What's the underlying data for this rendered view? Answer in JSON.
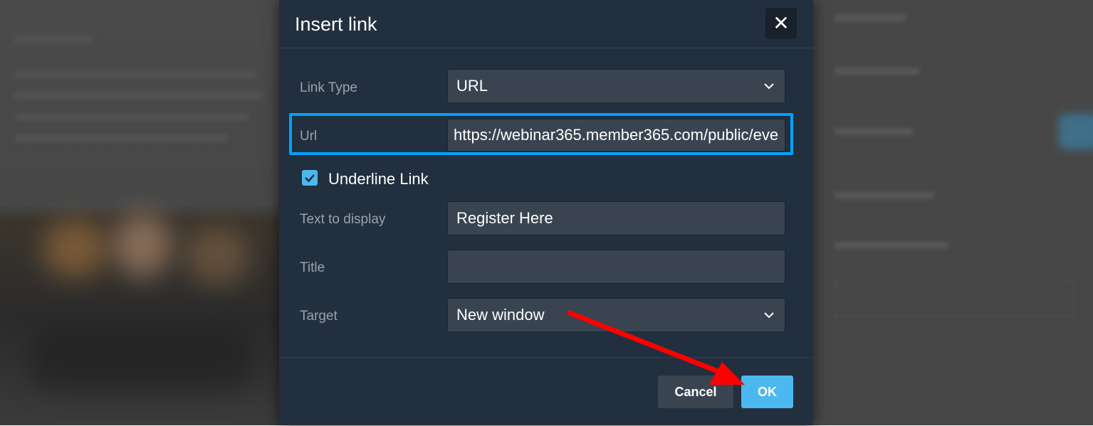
{
  "dialog": {
    "title": "Insert link",
    "close_glyph": "✕"
  },
  "fields": {
    "link_type_label": "Link Type",
    "link_type_value": "URL",
    "url_label": "Url",
    "url_value": "https://webinar365.member365.com/public/eve",
    "underline_label": "Underline Link",
    "underline_checked": true,
    "text_to_display_label": "Text to display",
    "text_to_display_value": "Register Here",
    "title_label": "Title",
    "title_value": "",
    "target_label": "Target",
    "target_value": "New window"
  },
  "footer": {
    "cancel_label": "Cancel",
    "ok_label": "OK"
  },
  "colors": {
    "dialog_bg": "#222f3e",
    "field_bg": "#3a4451",
    "accent": "#4cb8f0",
    "highlight": "#00a2ff",
    "annotation_arrow": "#ff0000"
  },
  "icons": {
    "close": "close-icon",
    "dropdown": "chevron-down-icon",
    "check": "checkmark-icon",
    "annotation": "red-arrow-annotation"
  }
}
